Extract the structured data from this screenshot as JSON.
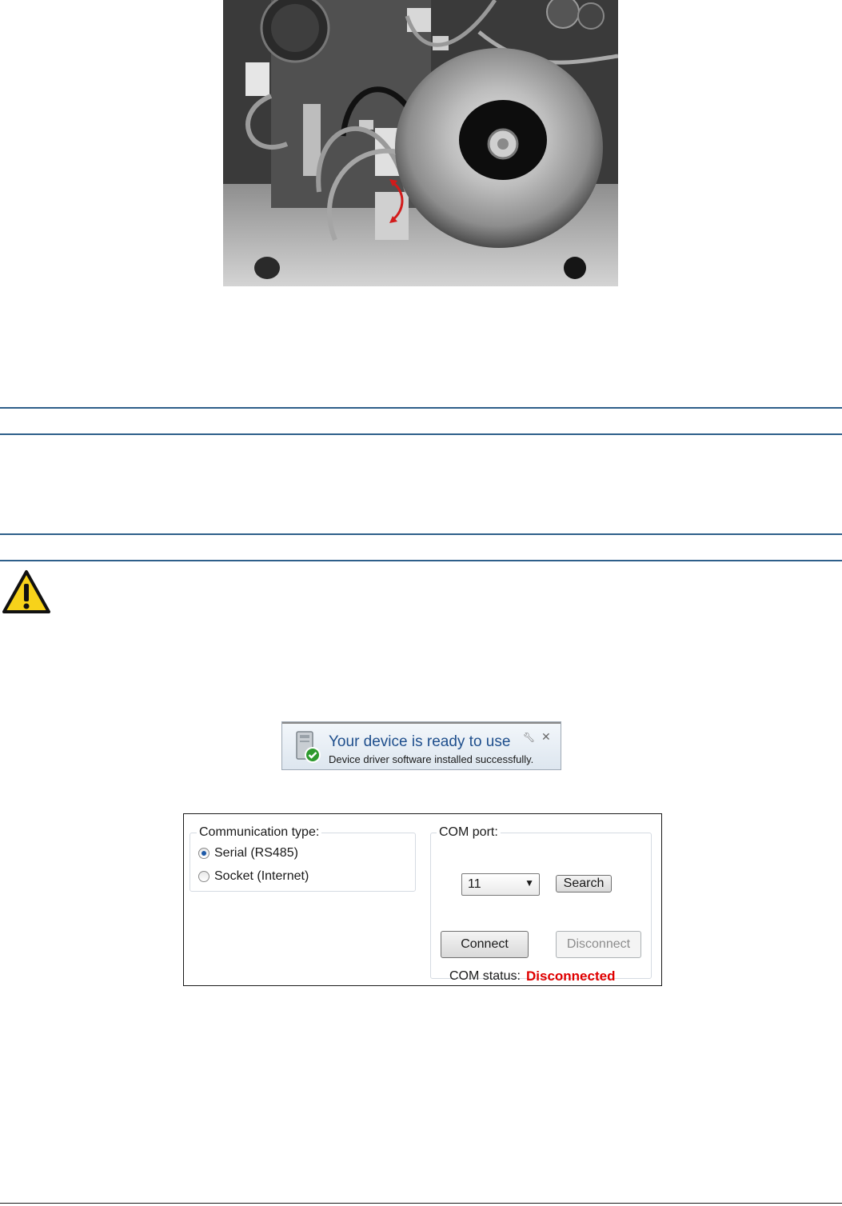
{
  "notification": {
    "title": "Your device is ready to use",
    "subtitle": "Device driver software installed successfully.",
    "icons": [
      "device-icon",
      "wrench-icon",
      "close-icon"
    ]
  },
  "communication": {
    "group_label": "Communication type:",
    "options": [
      {
        "label": "Serial (RS485)",
        "selected": true
      },
      {
        "label": "Socket (Internet)",
        "selected": false
      }
    ]
  },
  "com_port": {
    "group_label": "COM port:",
    "selected_port": "11",
    "search_label": "Search",
    "connect_label": "Connect",
    "disconnect_label": "Disconnect",
    "status_label": "COM status:",
    "status_value": "Disconnected"
  },
  "colors": {
    "rule": "#2e5f8a",
    "status_disconnected": "#e00000",
    "warning_fill": "#f7d21a",
    "notification_title": "#1e4e8c"
  }
}
